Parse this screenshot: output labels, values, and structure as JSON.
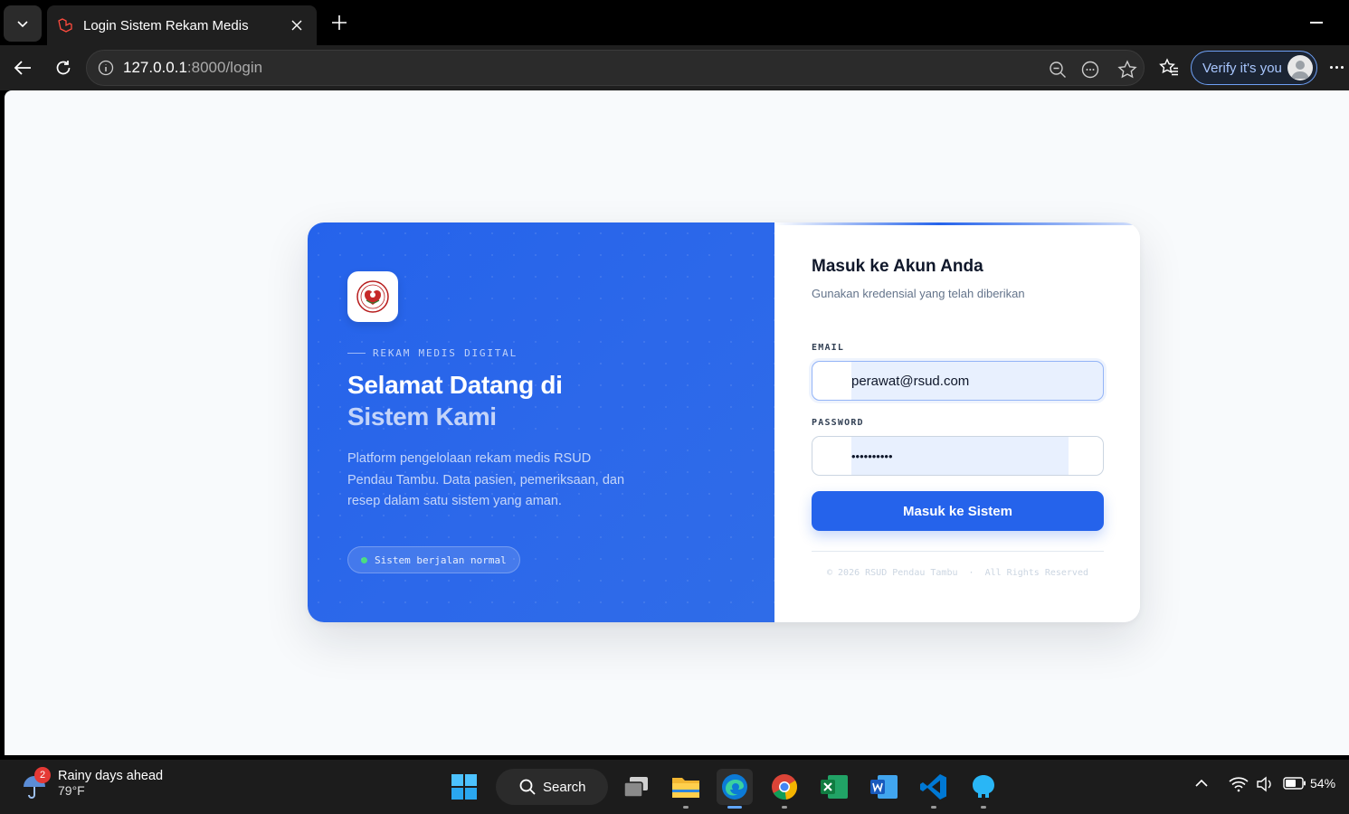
{
  "browser": {
    "tab_title": "Login Sistem Rekam Medis",
    "url_host": "127.0.0.1",
    "url_path": ":8000/login",
    "verify_label": "Verify it's you"
  },
  "hero": {
    "eyebrow": "REKAM MEDIS DIGITAL",
    "headline_line1": "Selamat Datang di",
    "headline_line2": "Sistem Kami",
    "description": "Platform pengelolaan rekam medis RSUD Pendau Tambu. Data pasien, pemeriksaan, dan resep dalam satu sistem yang aman.",
    "status": "Sistem berjalan normal",
    "status_color": "#4ade80"
  },
  "form": {
    "title": "Masuk ke Akun Anda",
    "subtitle": "Gunakan kredensial yang telah diberikan",
    "email_label": "EMAIL",
    "email_value": "perawat@rsud.com",
    "password_label": "PASSWORD",
    "password_value": "••••••••••",
    "submit_label": "Masuk ke Sistem",
    "footer": "© 2026 RSUD Pendau Tambu  ·  All Rights Reserved",
    "accent": "#2563eb"
  },
  "taskbar": {
    "weather_title": "Rainy days ahead",
    "weather_temp": "79°F",
    "weather_badge": "2",
    "search_label": "Search",
    "battery": "54%"
  }
}
